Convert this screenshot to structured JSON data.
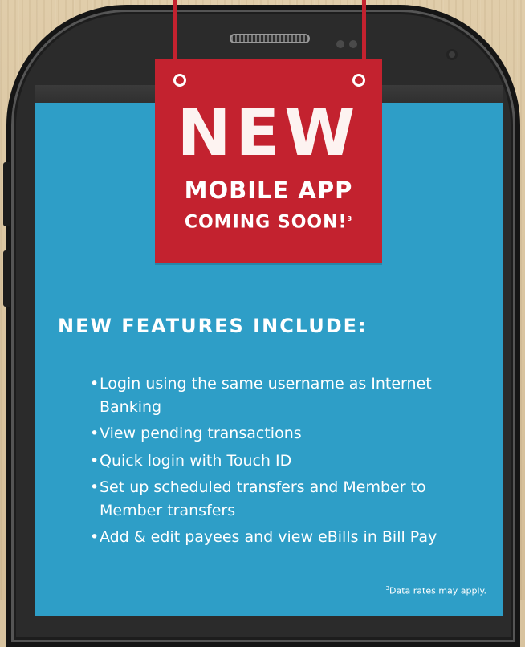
{
  "sign": {
    "headline": "NEW",
    "line2": "MOBILE APP",
    "line3": "COMING SOON!",
    "line3_footnote": "3"
  },
  "features": {
    "title": "NEW FEATURES INCLUDE:",
    "items": [
      "Login using the same username as Internet Banking",
      "View pending transactions",
      "Quick login with Touch ID",
      "Set up scheduled transfers and Member to Member transfers",
      "Add & edit payees and view eBills in Bill Pay"
    ]
  },
  "footnote": {
    "marker": "3",
    "text": "Data rates may apply."
  },
  "colors": {
    "sign_red": "#c3222f",
    "screen_blue": "#2e9ec7",
    "phone_body": "#2b2b2b",
    "background_wood": "#d8c39f"
  }
}
